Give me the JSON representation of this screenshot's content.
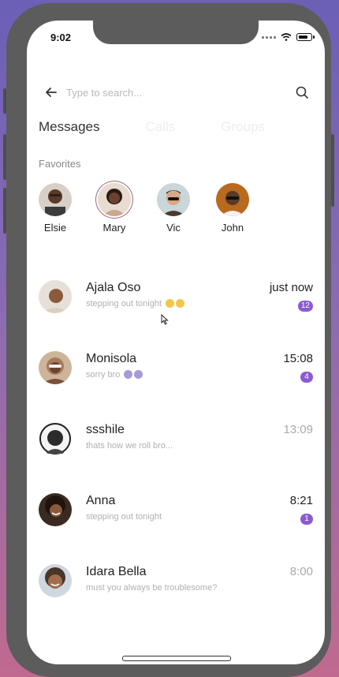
{
  "status": {
    "time": "9:02"
  },
  "search": {
    "placeholder": "Type to search..."
  },
  "tabs": [
    {
      "label": "Messages",
      "active": true
    },
    {
      "label": "Calls",
      "active": false
    },
    {
      "label": "Groups",
      "active": false
    }
  ],
  "favorites": {
    "label": "Favorites",
    "people": [
      {
        "name": "Elsie"
      },
      {
        "name": "Mary"
      },
      {
        "name": "Vic"
      },
      {
        "name": "John"
      }
    ]
  },
  "chats": [
    {
      "name": "Ajala Oso",
      "preview": "stepping out tonight",
      "time": "just now",
      "badge": "12",
      "emoji": "yellow"
    },
    {
      "name": "Monisola",
      "preview": "sorry bro",
      "time": "15:08",
      "badge": "4",
      "emoji": "purple"
    },
    {
      "name": "ssshile",
      "preview": "thats how we roll bro...",
      "time": "13:09",
      "badge": "",
      "emoji": ""
    },
    {
      "name": "Anna",
      "preview": "stepping out tonight",
      "time": "8:21",
      "badge": "1",
      "emoji": ""
    },
    {
      "name": "Idara Bella",
      "preview": "must you always be troublesome?",
      "time": "8:00",
      "badge": "",
      "emoji": ""
    }
  ],
  "colors": {
    "accent": "#8a5bd0",
    "background_top": "#6b5fb6",
    "background_bottom": "#c06a8f"
  }
}
